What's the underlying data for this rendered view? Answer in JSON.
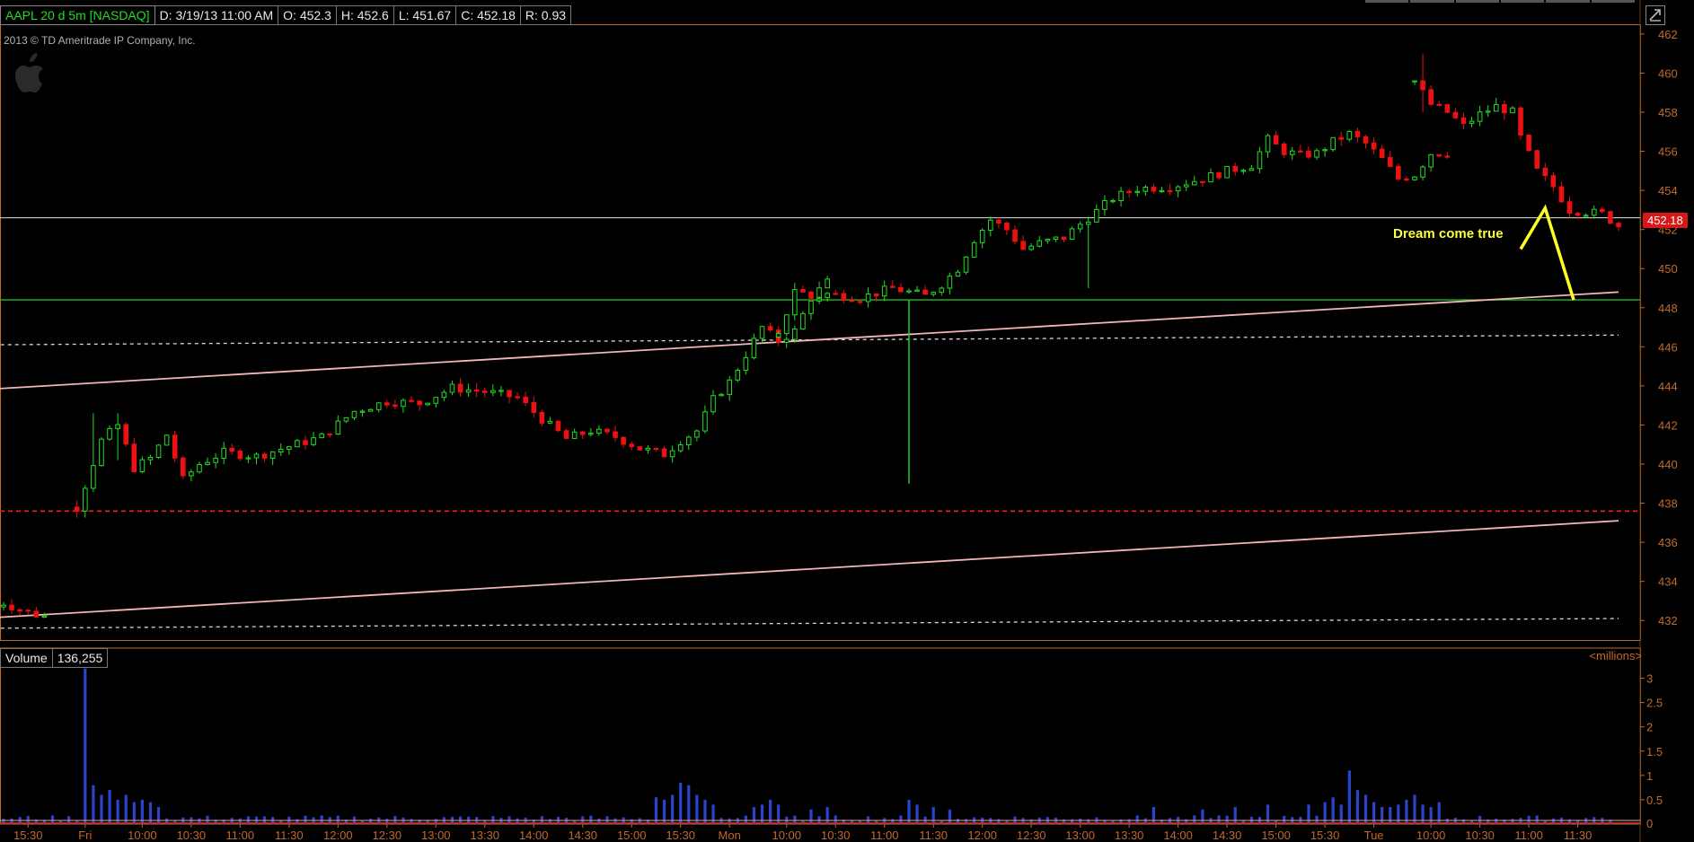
{
  "header": {
    "symbol": "AAPL 20 d 5m [NASDAQ]",
    "date": "D: 3/19/13 11:00 AM",
    "open": "O: 452.3",
    "high": "H: 452.6",
    "low": "L: 451.67",
    "close": "C: 452.18",
    "range": "R: 0.93"
  },
  "copyright": "2013 © TD Ameritrade IP Company, Inc.",
  "last_price": "452.18",
  "annotation": "Dream come true",
  "volume_panel": {
    "label": "Volume",
    "value": "136,255",
    "units": "<millions>"
  },
  "colors": {
    "up": "#22dd22",
    "down": "#ee1111",
    "axis_text": "#c06a2a",
    "trendline": "#f4b6b6",
    "horizontal_line": "#dfe4df",
    "support_line": "#22bb22",
    "red_dash": "#ee2222",
    "white_dash": "#d8d8d8",
    "annotation": "#ffff22",
    "volume": "#2a44cc"
  },
  "chart_data": {
    "type": "candlestick",
    "ylim": [
      431,
      462.5
    ],
    "y_ticks": [
      432,
      434,
      436,
      438,
      440,
      442,
      444,
      446,
      448,
      450,
      452,
      454,
      456,
      458,
      460,
      462
    ],
    "x_labels": [
      "15:00",
      "15:30",
      "Fri",
      "10:00",
      "10:30",
      "11:00",
      "11:30",
      "12:00",
      "12:30",
      "13:00",
      "13:30",
      "14:00",
      "14:30",
      "15:00",
      "15:30",
      "Mon",
      "10:00",
      "10:30",
      "11:00",
      "11:30",
      "12:00",
      "12:30",
      "13:00",
      "13:30",
      "14:00",
      "14:30",
      "15:00",
      "15:30",
      "Tue",
      "10:00",
      "10:30",
      "11:00",
      "11:30"
    ],
    "x_label_bars": [
      -3,
      3,
      10,
      17,
      23,
      29,
      35,
      41,
      47,
      53,
      59,
      65,
      71,
      77,
      83,
      89,
      96,
      102,
      108,
      114,
      120,
      126,
      132,
      138,
      144,
      150,
      156,
      162,
      168,
      175,
      181,
      187,
      193
    ],
    "bar_count": 198,
    "sessions": [
      {
        "start": -3,
        "end": 8,
        "open": 432.3,
        "points": [
          [
            0,
            432.3
          ],
          [
            3,
            432.9
          ],
          [
            6,
            432.4
          ],
          [
            8,
            432.2
          ]
        ],
        "spikes": []
      },
      {
        "start": 9,
        "end": 86,
        "open": 437.8,
        "points": [
          [
            0,
            437.8
          ],
          [
            3,
            441.2
          ],
          [
            5,
            442.0
          ],
          [
            7,
            439.8
          ],
          [
            9,
            440.3
          ],
          [
            11,
            441.5
          ],
          [
            13,
            439.2
          ],
          [
            15,
            440.0
          ],
          [
            18,
            440.6
          ],
          [
            22,
            440.4
          ],
          [
            26,
            440.9
          ],
          [
            30,
            441.4
          ],
          [
            34,
            442.7
          ],
          [
            38,
            443.2
          ],
          [
            42,
            443.1
          ],
          [
            46,
            443.9
          ],
          [
            50,
            443.7
          ],
          [
            54,
            443.4
          ],
          [
            57,
            442.3
          ],
          [
            60,
            441.3
          ],
          [
            63,
            441.7
          ],
          [
            66,
            441.4
          ],
          [
            69,
            440.8
          ],
          [
            72,
            440.5
          ],
          [
            74,
            441.2
          ],
          [
            76,
            441.7
          ],
          [
            78,
            443.3
          ],
          [
            80,
            444.2
          ],
          [
            82,
            445.6
          ],
          [
            84,
            447.0
          ],
          [
            86,
            446.3
          ],
          [
            88,
            446.8
          ],
          [
            90,
            448.5
          ],
          [
            92,
            449.3
          ]
        ],
        "spikes": [
          [
            2,
            442.6,
            439.5
          ],
          [
            5,
            442.6,
            440.2
          ]
        ]
      },
      {
        "start": 95,
        "end": 172,
        "open": 446.5,
        "points": [
          [
            0,
            446.5
          ],
          [
            2,
            449.0
          ],
          [
            4,
            448.5
          ],
          [
            6,
            448.7
          ],
          [
            10,
            448.5
          ],
          [
            14,
            449.0
          ],
          [
            18,
            448.6
          ],
          [
            20,
            449.2
          ],
          [
            22,
            450.0
          ],
          [
            24,
            451.5
          ],
          [
            26,
            452.5
          ],
          [
            28,
            452.0
          ],
          [
            30,
            451.0
          ],
          [
            32,
            451.3
          ],
          [
            35,
            451.6
          ],
          [
            38,
            452.6
          ],
          [
            41,
            453.6
          ],
          [
            44,
            454.1
          ],
          [
            48,
            454.2
          ],
          [
            52,
            454.6
          ],
          [
            55,
            455.0
          ],
          [
            58,
            455.3
          ],
          [
            60,
            456.6
          ],
          [
            62,
            456.0
          ],
          [
            64,
            455.8
          ],
          [
            66,
            455.9
          ],
          [
            68,
            456.5
          ],
          [
            70,
            456.9
          ],
          [
            72,
            456.4
          ],
          [
            74,
            455.6
          ],
          [
            76,
            454.6
          ],
          [
            78,
            454.8
          ],
          [
            80,
            455.9
          ],
          [
            82,
            455.9
          ]
        ],
        "spikes": [
          [
            38,
            450.5,
            449.0
          ]
        ]
      },
      {
        "start": 173,
        "end": 187,
        "open": 459.6,
        "points": [
          [
            0,
            459.6
          ],
          [
            2,
            458.4
          ],
          [
            4,
            458.0
          ],
          [
            6,
            457.3
          ],
          [
            8,
            457.9
          ],
          [
            10,
            458.3
          ],
          [
            12,
            458.0
          ],
          [
            13,
            456.7
          ],
          [
            15,
            455.0
          ],
          [
            17,
            454.2
          ],
          [
            19,
            453.0
          ],
          [
            21,
            452.9
          ],
          [
            23,
            452.8
          ],
          [
            25,
            452.18
          ]
        ],
        "spikes": [
          [
            1,
            461.0,
            458.0
          ]
        ]
      }
    ],
    "special_bar": {
      "bar": 111,
      "open": 448.3,
      "high": 448.4,
      "low": 439.0,
      "close": 448.4
    },
    "trendline_upper": [
      [
        -3,
        443.8
      ],
      [
        198,
        448.8
      ]
    ],
    "trendline_lower": [
      [
        -3,
        432.1
      ],
      [
        198,
        437.1
      ]
    ],
    "horizontal_line": 452.6,
    "support_line": 448.4,
    "red_dashed_line": 437.6,
    "white_dashed_upper": [
      [
        -3,
        446.1
      ],
      [
        198,
        446.6
      ]
    ],
    "white_dashed_lower": [
      [
        -3,
        431.6
      ],
      [
        198,
        432.1
      ]
    ],
    "projection": [
      [
        186,
        451.0
      ],
      [
        189,
        453.1
      ],
      [
        192.5,
        448.4
      ]
    ],
    "volume": {
      "ylim": [
        0,
        3.25
      ],
      "y_ticks": [
        0.5,
        1,
        1.5,
        2,
        2.5,
        3
      ],
      "tick_labels": [
        "0.5",
        "1",
        "1.5",
        "2",
        "2.5",
        "3"
      ],
      "baseline": 0.12,
      "spikes": [
        [
          10,
          3.2
        ],
        [
          11,
          0.8
        ],
        [
          12,
          0.6
        ],
        [
          13,
          0.7
        ],
        [
          14,
          0.5
        ],
        [
          15,
          0.6
        ],
        [
          16,
          0.45
        ],
        [
          17,
          0.5
        ],
        [
          18,
          0.45
        ],
        [
          19,
          0.35
        ],
        [
          80,
          0.55
        ],
        [
          81,
          0.5
        ],
        [
          82,
          0.6
        ],
        [
          83,
          0.85
        ],
        [
          84,
          0.8
        ],
        [
          85,
          0.6
        ],
        [
          86,
          0.5
        ],
        [
          87,
          0.4
        ],
        [
          92,
          0.35
        ],
        [
          93,
          0.4
        ],
        [
          94,
          0.5
        ],
        [
          95,
          0.4
        ],
        [
          99,
          0.3
        ],
        [
          101,
          0.35
        ],
        [
          111,
          0.5
        ],
        [
          112,
          0.4
        ],
        [
          114,
          0.35
        ],
        [
          116,
          0.3
        ],
        [
          141,
          0.35
        ],
        [
          147,
          0.3
        ],
        [
          151,
          0.35
        ],
        [
          155,
          0.4
        ],
        [
          160,
          0.4
        ],
        [
          162,
          0.45
        ],
        [
          163,
          0.55
        ],
        [
          164,
          0.4
        ],
        [
          165,
          1.1
        ],
        [
          166,
          0.7
        ],
        [
          167,
          0.6
        ],
        [
          168,
          0.45
        ],
        [
          169,
          0.35
        ],
        [
          170,
          0.35
        ],
        [
          171,
          0.4
        ],
        [
          172,
          0.5
        ],
        [
          173,
          0.6
        ],
        [
          174,
          0.4
        ],
        [
          175,
          0.35
        ],
        [
          176,
          0.45
        ]
      ]
    }
  }
}
